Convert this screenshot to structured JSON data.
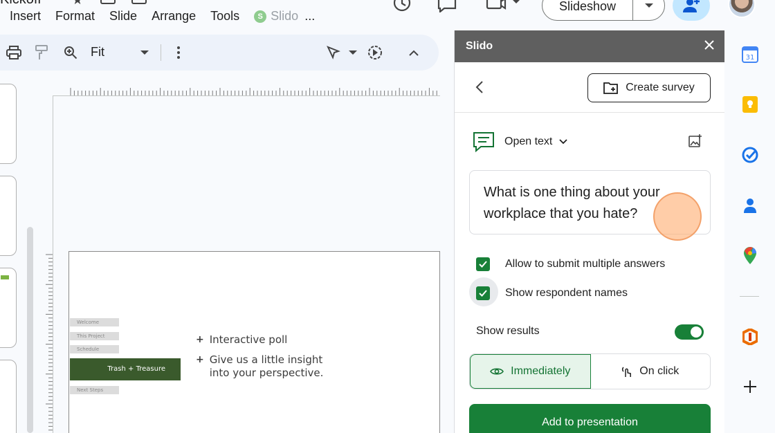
{
  "header": {
    "title_fragment": "Kickoff",
    "menus": [
      "Insert",
      "Format",
      "Slide",
      "Arrange",
      "Tools"
    ],
    "slido_menu": "Slido",
    "more_menu": "...",
    "slideshow_label": "Slideshow"
  },
  "toolbar": {
    "zoom_label": "Fit"
  },
  "slide": {
    "agenda": [
      "Welcome",
      "This Project",
      "Schedule",
      "Next Steps"
    ],
    "active_item": "Trash + Treasure",
    "bullets": [
      "Interactive poll",
      "Give us a little insight into your perspective."
    ]
  },
  "panel": {
    "title": "Slido",
    "create_survey_label": "Create survey",
    "question_type": "Open text",
    "question_text": "What is one thing about your workplace that you hate?",
    "options": [
      {
        "label": "Allow to submit multiple answers",
        "checked": true
      },
      {
        "label": "Show respondent names",
        "checked": true
      }
    ],
    "show_results_label": "Show results",
    "show_results_on": true,
    "results_timing": [
      {
        "label": "Immediately",
        "selected": true
      },
      {
        "label": "On click",
        "selected": false
      }
    ],
    "add_button_label": "Add to presentation"
  },
  "rail": {
    "calendar_day": "31",
    "icons": [
      "calendar-icon",
      "keep-icon",
      "tasks-icon",
      "contacts-icon",
      "maps-icon",
      "office-icon",
      "add-icon"
    ]
  },
  "colors": {
    "accent_green": "#188038",
    "panel_header": "#5f5f5f",
    "slide_active": "#3a5a2c"
  }
}
